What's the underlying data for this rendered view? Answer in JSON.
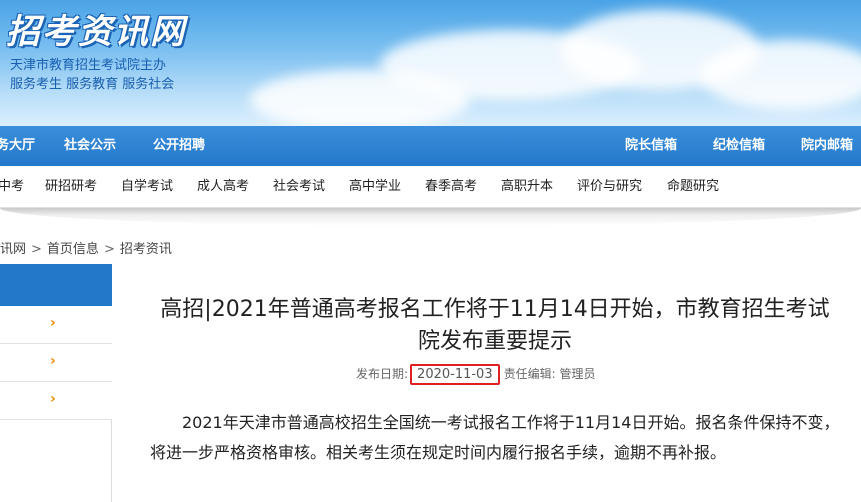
{
  "header": {
    "site_title": "招考资讯网",
    "subtitle_line1": "天津市教育招生考试院主办",
    "subtitle_line2": "服务考生 服务教育 服务社会"
  },
  "primary_nav": {
    "left_items": [
      "务大厅",
      "社会公示",
      "公开招聘"
    ],
    "right_items": [
      "院长信箱",
      "纪检信箱",
      "院内邮箱"
    ]
  },
  "secondary_nav": {
    "items": [
      "中考",
      "研招研考",
      "自学考试",
      "成人高考",
      "社会考试",
      "高中学业",
      "春季高考",
      "高职升本",
      "评价与研究",
      "命题研究"
    ]
  },
  "breadcrumb": {
    "items": [
      "讯网",
      "首页信息",
      "招考资讯"
    ],
    "separator": ">"
  },
  "sidebar": {
    "arrow_glyph": "›"
  },
  "article": {
    "title": "高招|2021年普通高考报名工作将于11月14日开始，市教育招生考试院发布重要提示",
    "date_label": "发布日期:",
    "date": "2020-11-03",
    "editor_label": "责任编辑:",
    "editor": "管理员",
    "body": "2021年天津市普通高校招生全国统一考试报名工作将于11月14日开始。报名条件保持不变，将进一步严格资格审核。相关考生须在规定时间内履行报名手续，逾期不再补报。"
  },
  "colors": {
    "nav_blue": "#2478c9",
    "highlight_red": "#e02020",
    "arrow_orange": "#f08a00"
  }
}
